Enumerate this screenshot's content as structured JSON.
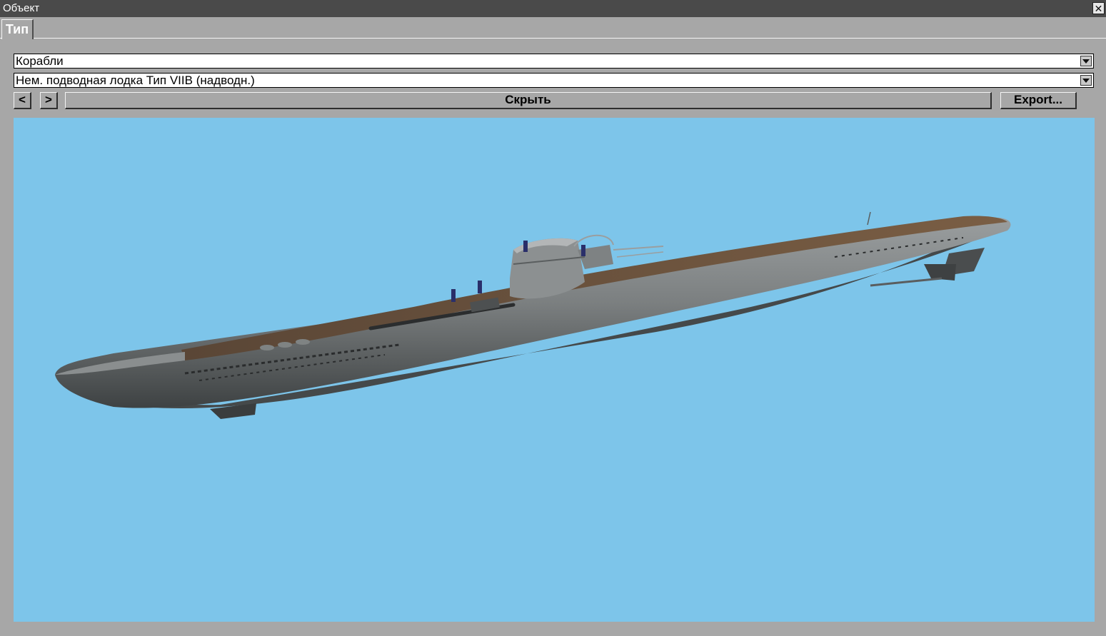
{
  "window": {
    "title": "Объект",
    "close_label": "✕"
  },
  "tabs": [
    {
      "label": "Тип"
    }
  ],
  "category_select": {
    "value": "Корабли"
  },
  "object_select": {
    "value": "Нем. подводная лодка Тип VIIB (надводн.)"
  },
  "toolbar": {
    "prev_label": "<",
    "next_label": ">",
    "hide_label": "Скрыть",
    "export_label": "Export..."
  },
  "viewport": {
    "background": "#7dc5ea",
    "model": "submarine-type-viib-surfaced"
  },
  "colors": {
    "frame": "#a7a7a7",
    "titlebar": "#4a4a4a",
    "hull": "#6f7375",
    "deck": "#6b513a"
  }
}
